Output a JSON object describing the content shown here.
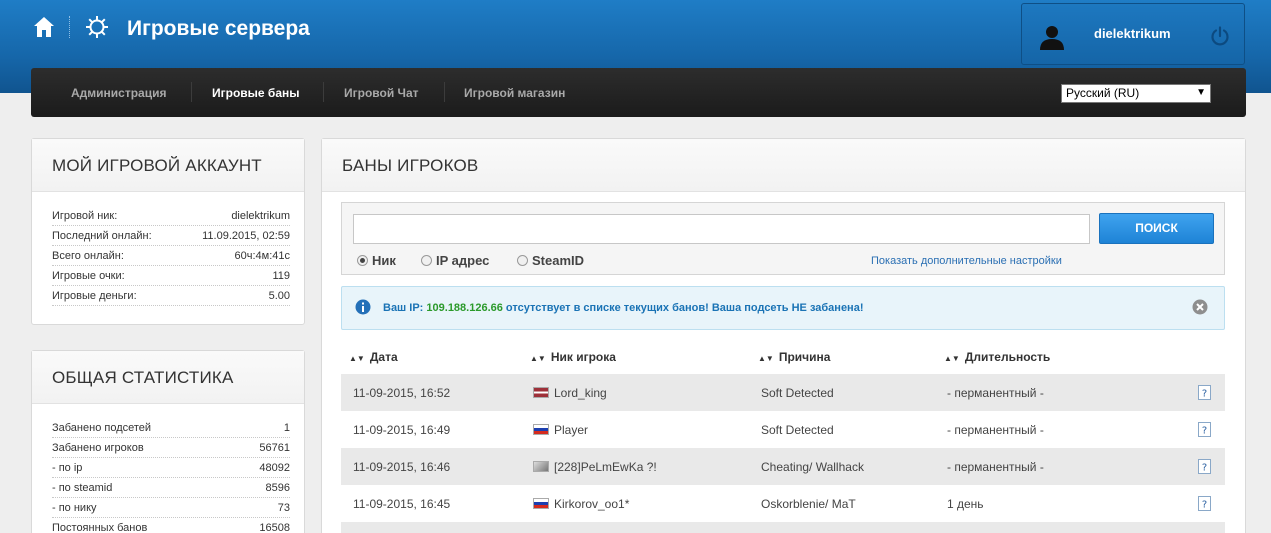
{
  "header": {
    "title": "Игровые сервера",
    "username": "dielektrikum"
  },
  "nav": {
    "items": [
      {
        "label": "Администрация",
        "active": false
      },
      {
        "label": "Игровые баны",
        "active": true
      },
      {
        "label": "Игровой Чат",
        "active": false
      },
      {
        "label": "Игровой магазин",
        "active": false
      }
    ],
    "language": "Русский (RU)"
  },
  "account": {
    "title": "МОЙ ИГРОВОЙ АККАУНТ",
    "rows": [
      {
        "label": "Игровой ник:",
        "value": "dielektrikum"
      },
      {
        "label": "Последний онлайн:",
        "value": "11.09.2015, 02:59"
      },
      {
        "label": "Всего онлайн:",
        "value": "60ч:4м:41с"
      },
      {
        "label": "Игровые очки:",
        "value": "119"
      },
      {
        "label": "Игровые деньги:",
        "value": "5.00"
      }
    ]
  },
  "stats": {
    "title": "ОБЩАЯ СТАТИСТИКА",
    "rows": [
      {
        "label": "Забанено подсетей",
        "value": "1"
      },
      {
        "label": "Забанено игроков",
        "value": "56761"
      },
      {
        "label": "- по ip",
        "value": "48092"
      },
      {
        "label": "- по steamid",
        "value": "8596"
      },
      {
        "label": "- по нику",
        "value": "73"
      },
      {
        "label": "Постоянных банов",
        "value": "16508"
      }
    ]
  },
  "bans": {
    "title": "БАНЫ ИГРОКОВ",
    "search": {
      "value": "",
      "button": "ПОИСК",
      "options": [
        {
          "label": "Ник",
          "checked": true
        },
        {
          "label": "IP адрес",
          "checked": false
        },
        {
          "label": "SteamID",
          "checked": false
        }
      ],
      "advanced_link": "Показать дополнительные настройки"
    },
    "alert": {
      "prefix": "Ваш IP: ",
      "ip": "109.188.126.66",
      "suffix": " отсутствует в списке текущих банов! Ваша подсеть НЕ забанена!"
    },
    "columns": [
      "Дата",
      "Ник игрока",
      "Причина",
      "Длительность"
    ],
    "rows": [
      {
        "date": "11-09-2015, 16:52",
        "flag": "lv",
        "nick": "Lord_king",
        "reason": "Soft Detected",
        "duration": "- перманентный -"
      },
      {
        "date": "11-09-2015, 16:49",
        "flag": "ru",
        "nick": "Player",
        "reason": "Soft Detected",
        "duration": "- перманентный -"
      },
      {
        "date": "11-09-2015, 16:46",
        "flag": "unk",
        "nick": "[228]PeLmEwKa ?!",
        "reason": "Cheating/ Wallhack",
        "duration": "- перманентный -"
      },
      {
        "date": "11-09-2015, 16:45",
        "flag": "ru",
        "nick": "Kirkorov_oo1*",
        "reason": "Oskorblenie/ MaT",
        "duration": "1 день"
      }
    ]
  }
}
